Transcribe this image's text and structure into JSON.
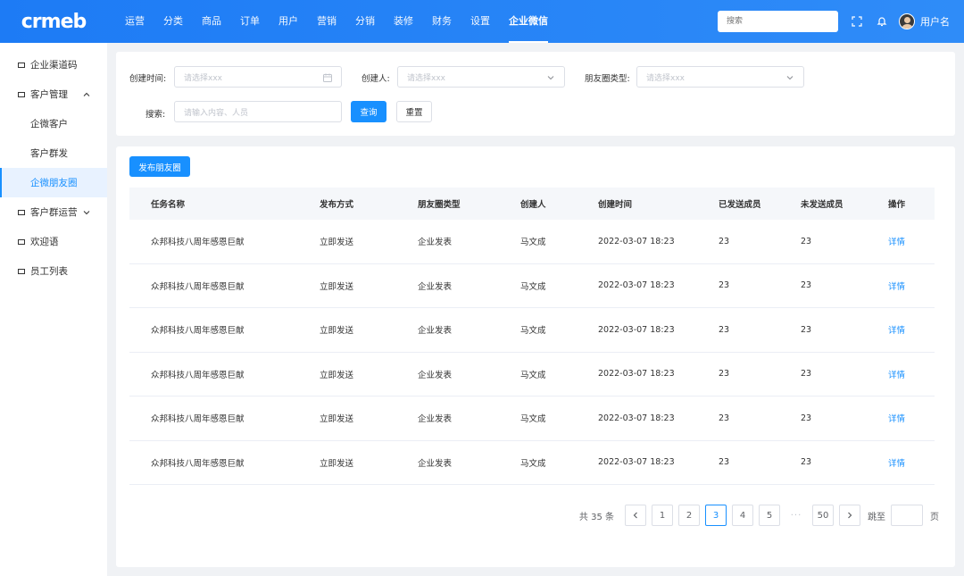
{
  "header": {
    "logo": "crmeb",
    "nav": [
      "运营",
      "分类",
      "商品",
      "订单",
      "用户",
      "营销",
      "分销",
      "装修",
      "财务",
      "设置",
      "企业微信"
    ],
    "active_nav": "企业微信",
    "search_placeholder": "搜索",
    "user_name": "用户名"
  },
  "sidebar": {
    "items": [
      {
        "label": "企业渠道码",
        "type": "top"
      },
      {
        "label": "客户管理",
        "type": "group-open"
      },
      {
        "label": "企微客户",
        "type": "sub"
      },
      {
        "label": "客户群发",
        "type": "sub"
      },
      {
        "label": "企微朋友圈",
        "type": "sub-active"
      },
      {
        "label": "客户群运营",
        "type": "group-closed"
      },
      {
        "label": "欢迎语",
        "type": "top"
      },
      {
        "label": "员工列表",
        "type": "top"
      }
    ]
  },
  "filters": {
    "create_time_label": "创建时间:",
    "create_time_placeholder": "请选择xxx",
    "creator_label": "创建人:",
    "creator_placeholder": "请选择xxx",
    "moment_type_label": "朋友圈类型:",
    "moment_type_placeholder": "请选择xxx",
    "search_label": "搜索:",
    "search_placeholder": "请输入内容、人员",
    "query_button": "查询",
    "reset_button": "重置"
  },
  "main": {
    "publish_button": "发布朋友圈",
    "columns": [
      "任务名称",
      "发布方式",
      "朋友圈类型",
      "创建人",
      "创建时间",
      "已发送成员",
      "未发送成员",
      "操作"
    ],
    "rows": [
      [
        "众邦科技八周年感恩巨献",
        "立即发送",
        "企业发表",
        "马文成",
        "2022-03-07 18:23",
        "23",
        "23",
        "详情"
      ],
      [
        "众邦科技八周年感恩巨献",
        "立即发送",
        "企业发表",
        "马文成",
        "2022-03-07 18:23",
        "23",
        "23",
        "详情"
      ],
      [
        "众邦科技八周年感恩巨献",
        "立即发送",
        "企业发表",
        "马文成",
        "2022-03-07 18:23",
        "23",
        "23",
        "详情"
      ],
      [
        "众邦科技八周年感恩巨献",
        "立即发送",
        "企业发表",
        "马文成",
        "2022-03-07 18:23",
        "23",
        "23",
        "详情"
      ],
      [
        "众邦科技八周年感恩巨献",
        "立即发送",
        "企业发表",
        "马文成",
        "2022-03-07 18:23",
        "23",
        "23",
        "详情"
      ],
      [
        "众邦科技八周年感恩巨献",
        "立即发送",
        "企业发表",
        "马文成",
        "2022-03-07 18:23",
        "23",
        "23",
        "详情"
      ]
    ]
  },
  "pagination": {
    "total_text": "共 35 条",
    "pages": [
      "1",
      "2",
      "3",
      "4",
      "5",
      "50"
    ],
    "current": "3",
    "ellipsis": "···",
    "jump_label": "跳至",
    "page_unit": "页"
  },
  "colors": {
    "primary": "#1890ff",
    "header_start": "#1d7bf5",
    "header_end": "#2f8cf8",
    "background": "#f0f2f5"
  },
  "icons": [
    "calendar-icon",
    "chevron-down-icon",
    "chevron-up-icon",
    "fullscreen-icon",
    "bell-icon",
    "chevron-left-icon",
    "chevron-right-icon"
  ]
}
